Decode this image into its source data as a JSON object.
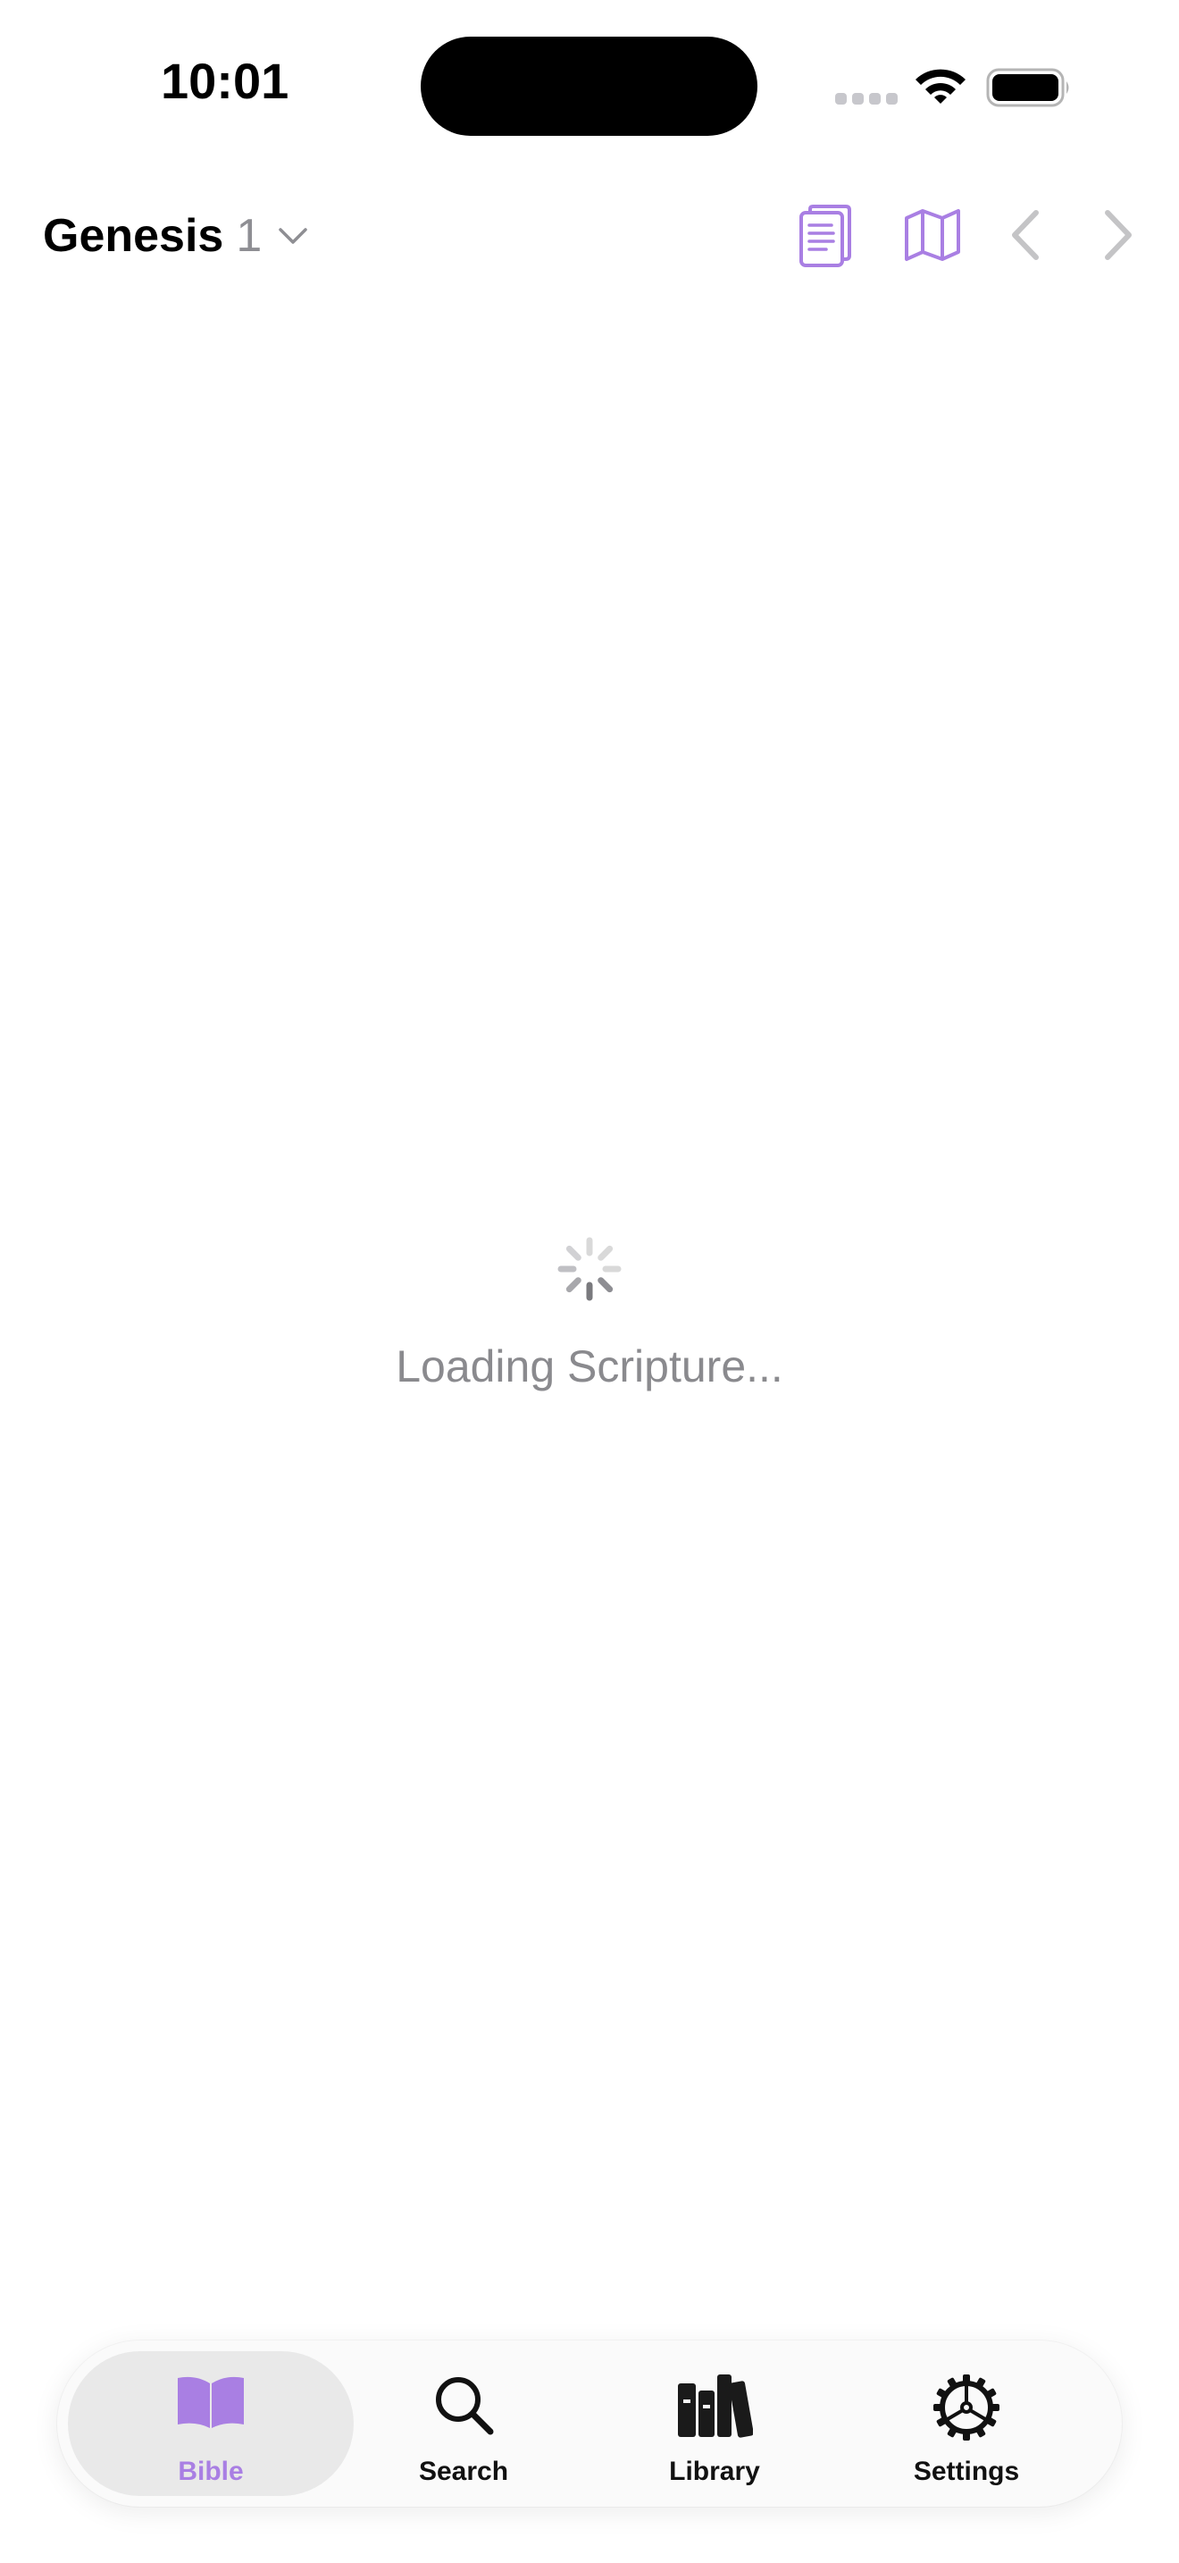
{
  "status_bar": {
    "time": "10:01"
  },
  "header": {
    "book": "Genesis",
    "chapter": "1",
    "icons": [
      "chevron-down-icon",
      "reader-icon",
      "map-icon",
      "chevron-left-icon",
      "chevron-right-icon"
    ]
  },
  "main": {
    "loading_text": "Loading Scripture..."
  },
  "tab_bar": {
    "tabs": [
      {
        "label": "Bible",
        "icon": "book-icon",
        "active": true
      },
      {
        "label": "Search",
        "icon": "search-icon",
        "active": false
      },
      {
        "label": "Library",
        "icon": "library-icon",
        "active": false
      },
      {
        "label": "Settings",
        "icon": "gear-icon",
        "active": false
      }
    ]
  },
  "colors": {
    "accent": "#a97fe3",
    "secondary_text": "#8a8a8e",
    "disabled_icon": "#c4c4c6"
  }
}
